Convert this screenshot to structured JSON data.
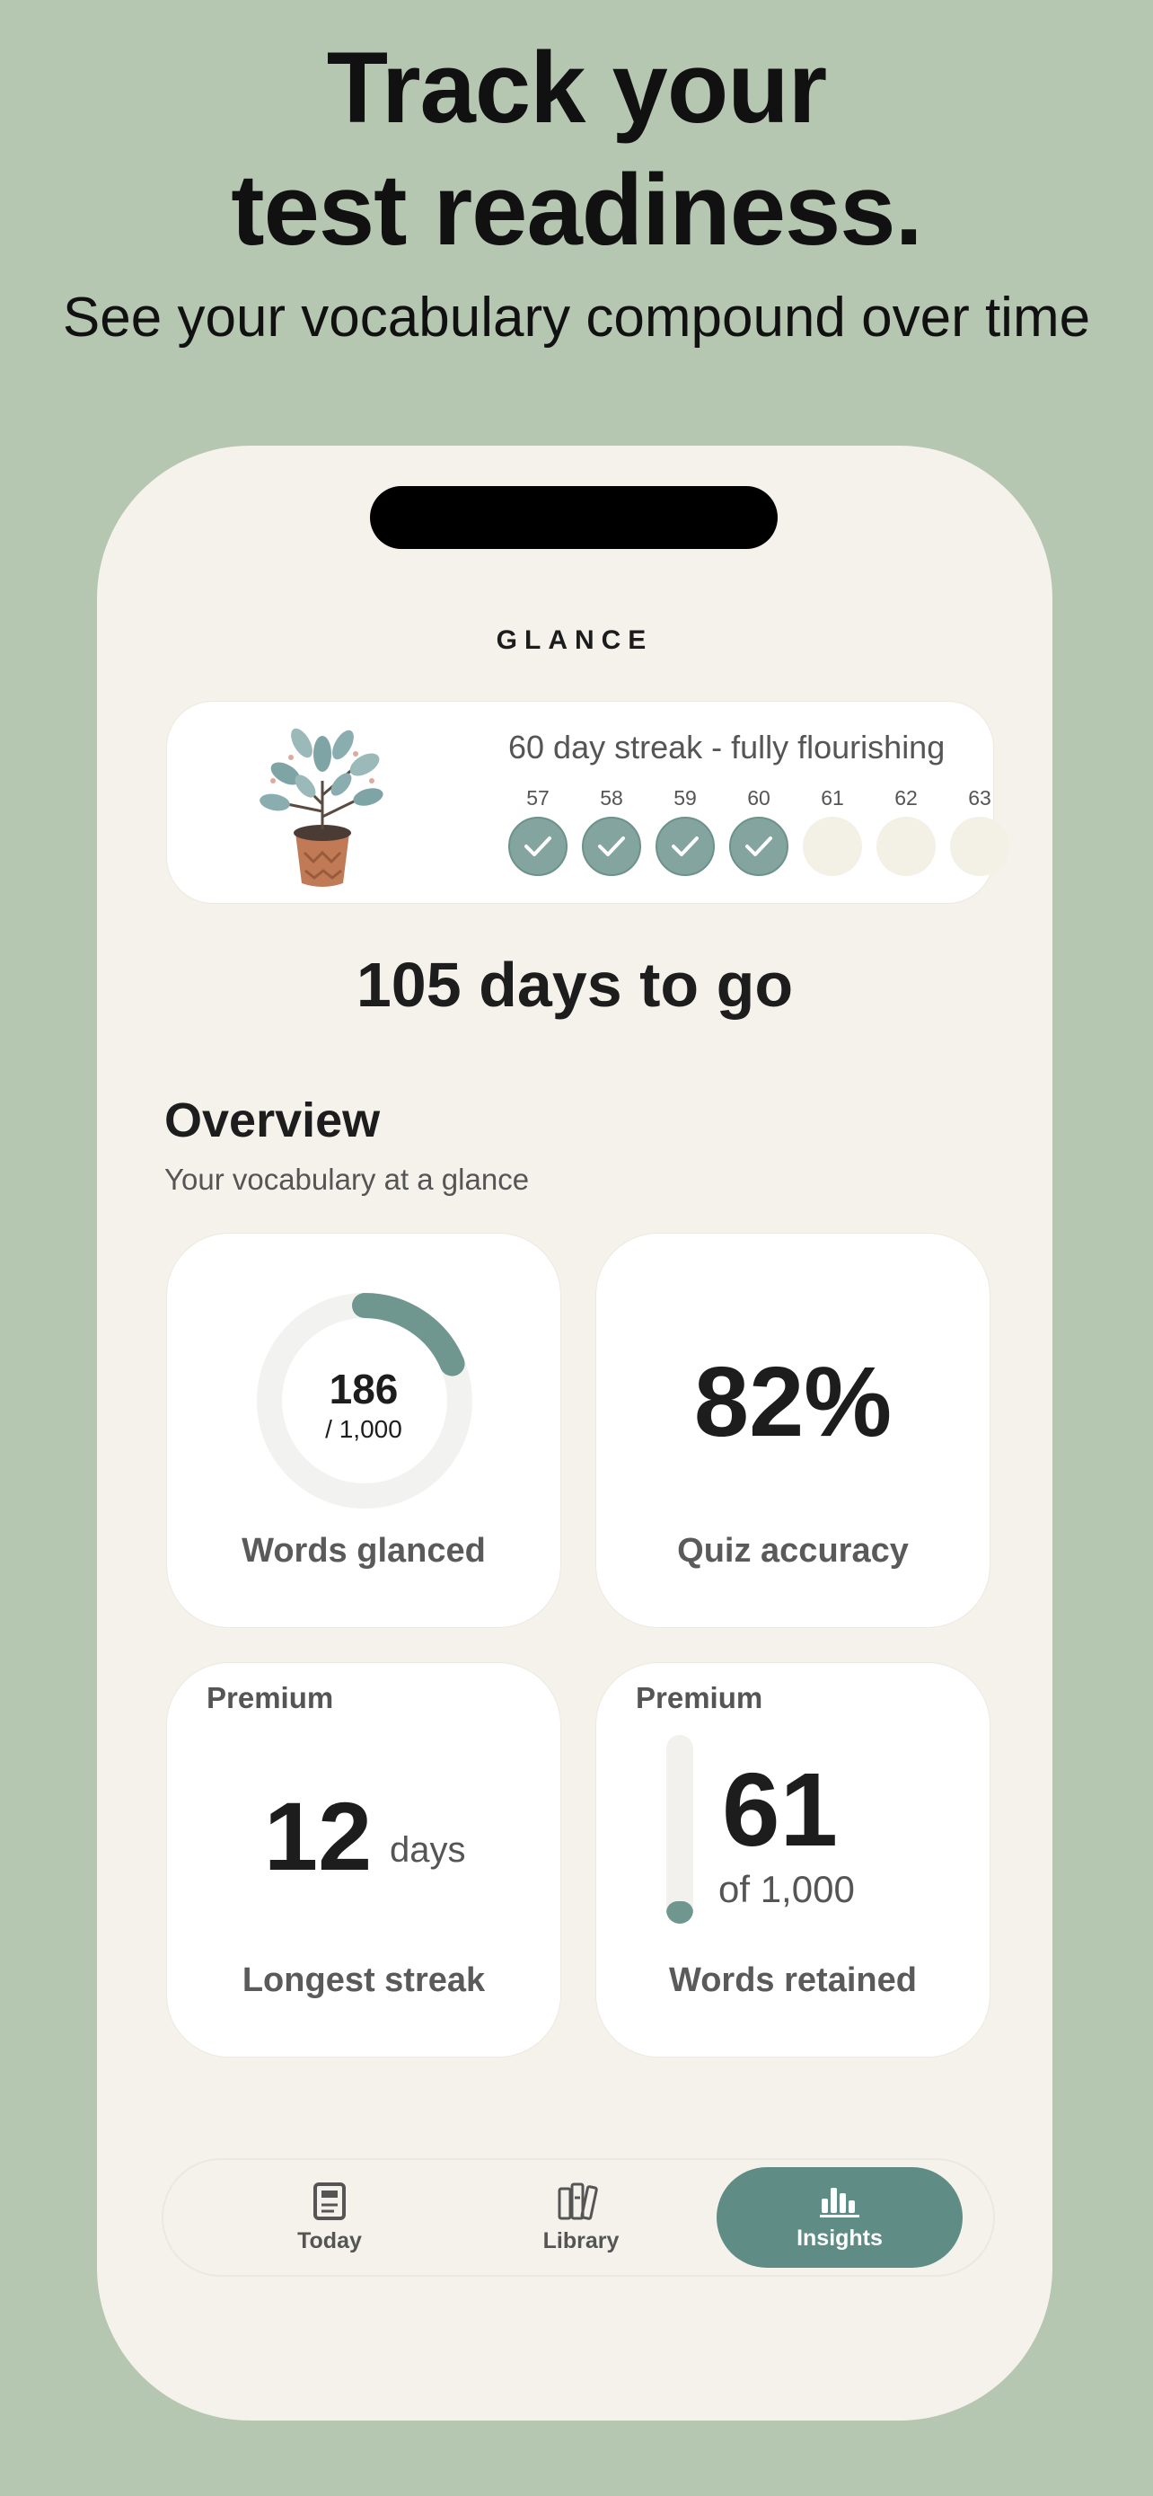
{
  "headline": {
    "line1": "Track your",
    "line2": "test readiness."
  },
  "subheadline": "See your vocabulary compound over time",
  "app": {
    "title": "GLANCE"
  },
  "streak": {
    "title": "60 day streak - fully flourishing",
    "days": [
      {
        "num": "57",
        "done": true
      },
      {
        "num": "58",
        "done": true
      },
      {
        "num": "59",
        "done": true
      },
      {
        "num": "60",
        "done": true
      },
      {
        "num": "61",
        "done": false
      },
      {
        "num": "62",
        "done": false
      },
      {
        "num": "63",
        "done": false
      }
    ]
  },
  "countdown": "105 days to go",
  "overview": {
    "title": "Overview",
    "subtitle": "Your vocabulary at a glance",
    "words_glanced": {
      "value": "186",
      "total": "/ 1,000",
      "label": "Words glanced",
      "fraction": 0.186
    },
    "quiz": {
      "value": "82%",
      "label": "Quiz accuracy"
    },
    "longest_streak": {
      "badge": "Premium",
      "value": "12",
      "unit": "days",
      "label": "Longest streak"
    },
    "retained": {
      "badge": "Premium",
      "value": "61",
      "of": "of 1,000",
      "label": "Words retained",
      "fraction": 0.061
    }
  },
  "tabs": [
    {
      "label": "Today",
      "icon": "book-icon",
      "active": false
    },
    {
      "label": "Library",
      "icon": "books-icon",
      "active": false
    },
    {
      "label": "Insights",
      "icon": "bar-chart-icon",
      "active": true
    }
  ],
  "colors": {
    "background": "#b5c6b1",
    "accent": "#5f8d86",
    "phone": "#f4f2eb"
  }
}
